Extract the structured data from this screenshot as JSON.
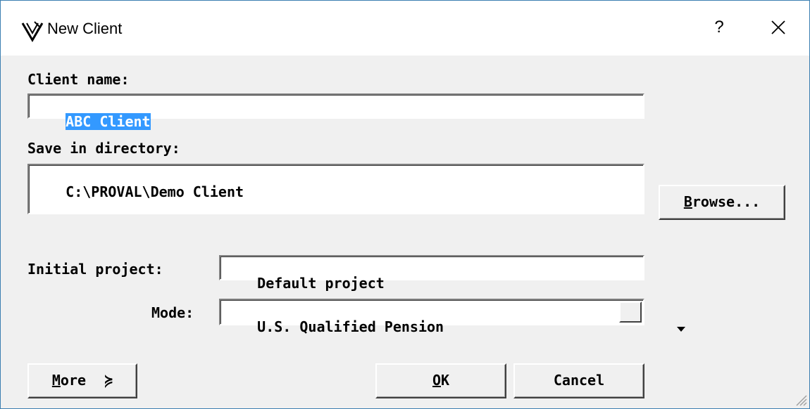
{
  "window": {
    "title": "New Client",
    "help": "?"
  },
  "form": {
    "client_name_label": "Client name:",
    "client_name_value": "ABC Client",
    "directory_label": "Save in directory:",
    "directory_value": "C:\\PROVAL\\Demo Client",
    "initial_project_label": "Initial project:",
    "initial_project_value": "Default project",
    "mode_label": "Mode:",
    "mode_value": "U.S. Qualified Pension"
  },
  "buttons": {
    "browse": {
      "accel": "B",
      "rest": "rowse..."
    },
    "more": {
      "accel": "M",
      "rest": "ore",
      "chevron": "≽"
    },
    "ok": {
      "accel": "O",
      "rest": "K"
    },
    "cancel": {
      "label": "Cancel"
    }
  },
  "colors": {
    "selection": "#3399ff",
    "window_border": "#3c7fb1"
  }
}
